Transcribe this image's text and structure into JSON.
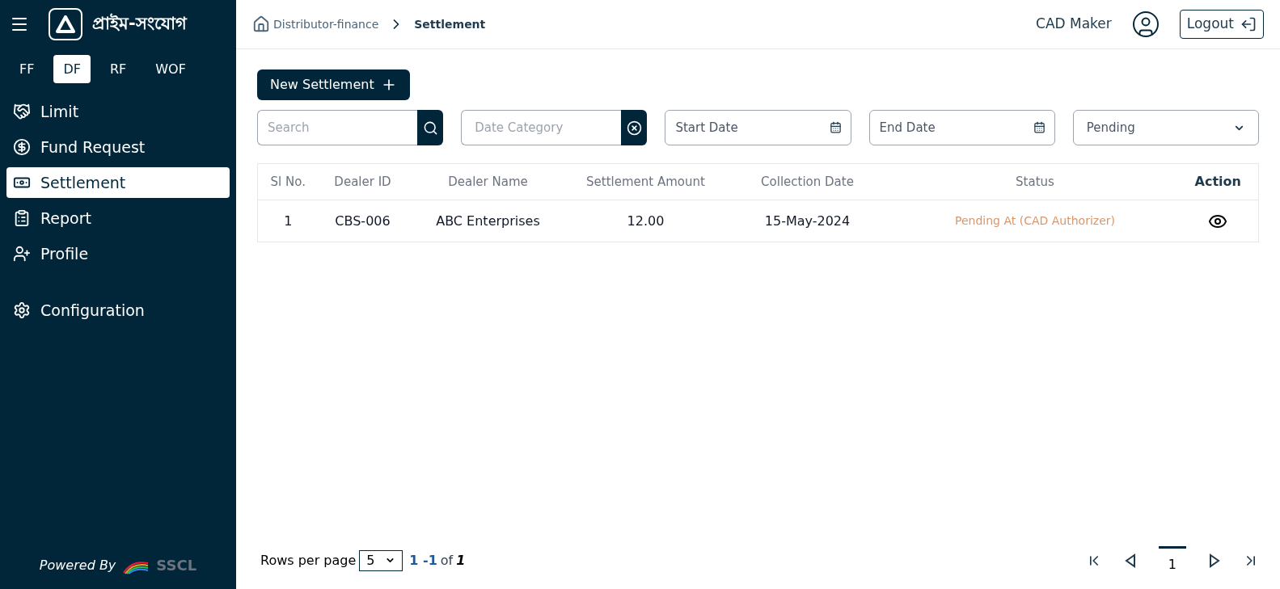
{
  "sidebar": {
    "brand": "প্রাইম-সংযোগ",
    "product_tabs": [
      {
        "label": "FF",
        "selected": false
      },
      {
        "label": "DF",
        "selected": true
      },
      {
        "label": "RF",
        "selected": false
      },
      {
        "label": "WOF",
        "selected": false
      }
    ],
    "items": [
      {
        "label": "Limit",
        "selected": false
      },
      {
        "label": "Fund Request",
        "selected": false
      },
      {
        "label": "Settlement",
        "selected": true
      },
      {
        "label": "Report",
        "selected": false
      },
      {
        "label": "Profile",
        "selected": false
      }
    ],
    "configuration": {
      "label": "Configuration",
      "selected": false
    },
    "footer": {
      "powered_by": "Powered By",
      "logo_text": "SSCL"
    }
  },
  "header": {
    "breadcrumb": [
      "Distributor-finance",
      "Settlement"
    ],
    "user": "CAD Maker",
    "logout": "Logout"
  },
  "toolbar": {
    "new_button": "New Settlement"
  },
  "filters": {
    "search": {
      "placeholder": "Search"
    },
    "date_category": {
      "placeholder": "Date Category"
    },
    "start_date": {
      "placeholder": "Start Date"
    },
    "end_date": {
      "placeholder": "End Date"
    },
    "status": {
      "value": "Pending"
    }
  },
  "table": {
    "columns": [
      "Sl No.",
      "Dealer ID",
      "Dealer Name",
      "Settlement Amount",
      "Collection Date",
      "Status",
      "Action"
    ],
    "rows": [
      {
        "sl": "1",
        "dealer_id": "CBS-006",
        "dealer_name": "ABC Enterprises",
        "amount": "12.00",
        "date": "15-May-2024",
        "status": "Pending At (CAD Authorizer)"
      }
    ]
  },
  "pagination": {
    "rows_label": "Rows per page",
    "rows_value": "5",
    "range": "1 -1",
    "of": "of",
    "total": "1",
    "current_page": "1"
  }
}
